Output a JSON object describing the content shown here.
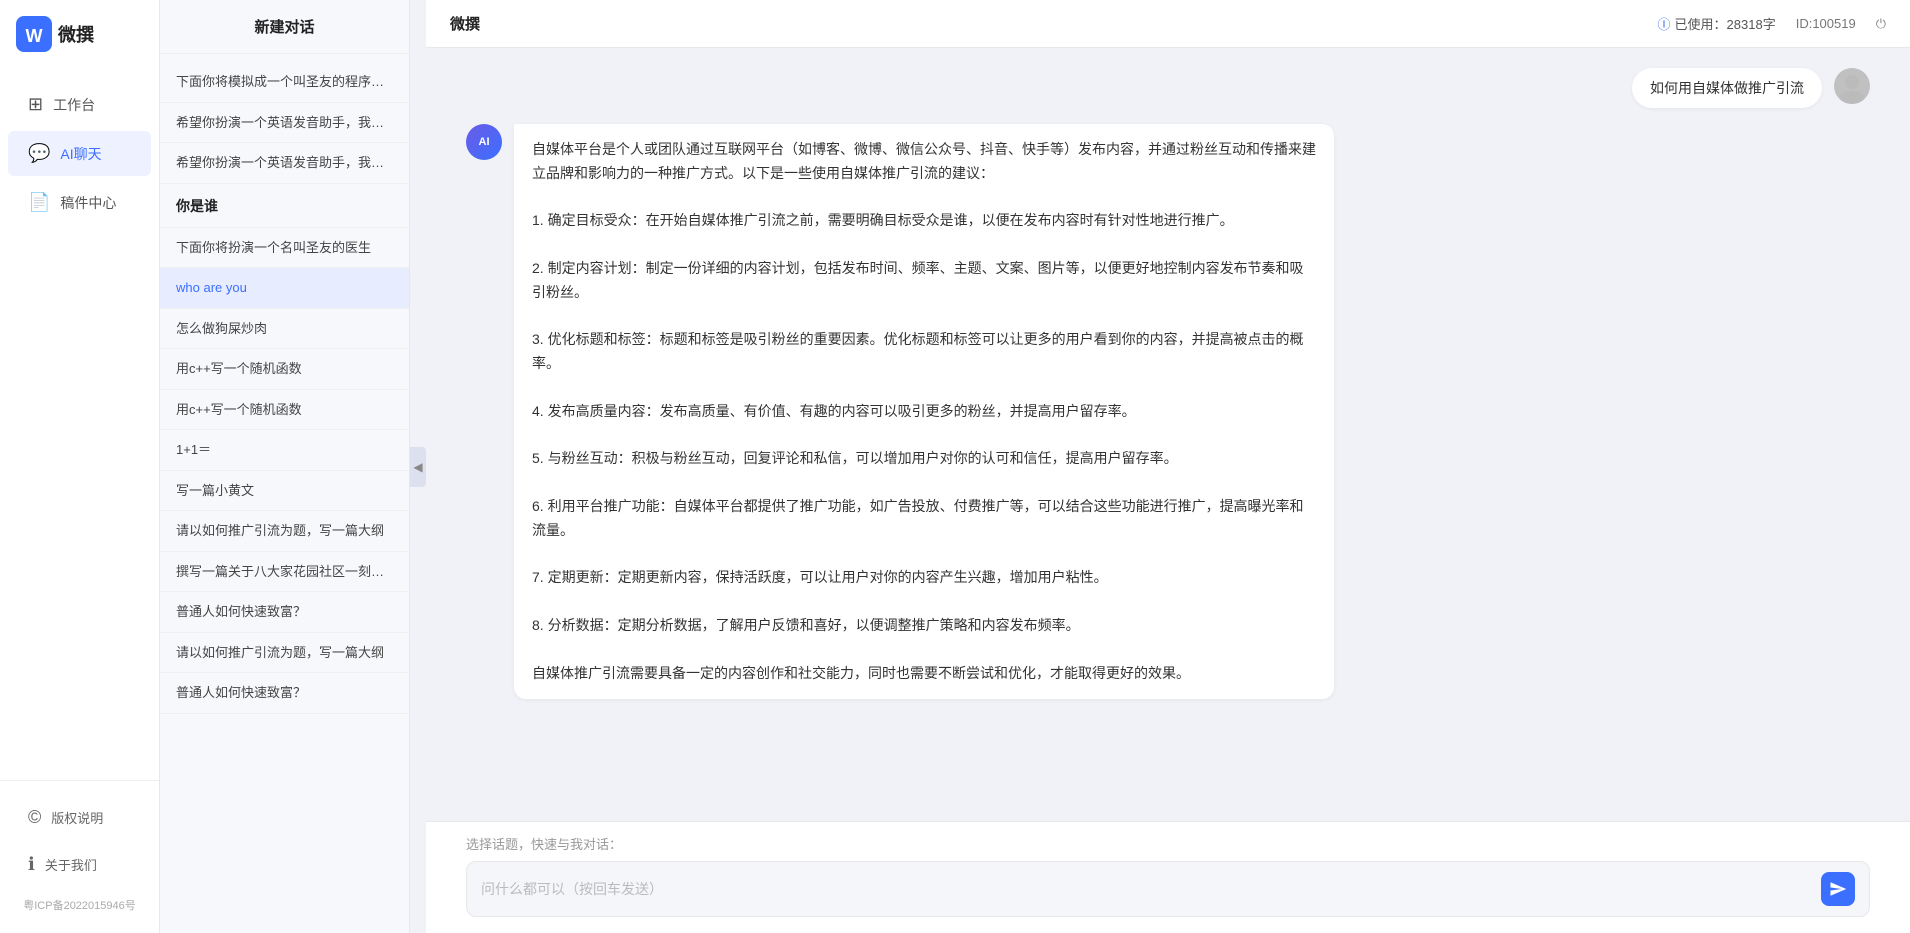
{
  "app": {
    "title": "微撰",
    "logo_text": "微撰"
  },
  "topbar": {
    "title": "微撰",
    "token_label": "已使用：28318字",
    "id_label": "ID:100519",
    "token_icon": "ℹ"
  },
  "left_nav": {
    "items": [
      {
        "id": "workbench",
        "label": "工作台",
        "icon": "⊞"
      },
      {
        "id": "ai-chat",
        "label": "AI聊天",
        "icon": "💬",
        "active": true
      },
      {
        "id": "drafts",
        "label": "稿件中心",
        "icon": "📄"
      }
    ],
    "bottom_items": [
      {
        "id": "copyright",
        "label": "版权说明",
        "icon": "©"
      },
      {
        "id": "about",
        "label": "关于我们",
        "icon": "ℹ"
      }
    ],
    "icp": "粤ICP备2022015946号"
  },
  "conversation_list": {
    "new_chat_label": "新建对话",
    "items": [
      {
        "id": 1,
        "text": "下面你将模拟成一个叫圣友的程序员，我说...",
        "active": false
      },
      {
        "id": 2,
        "text": "希望你扮演一个英语发音助手，我提供给你...",
        "active": false
      },
      {
        "id": 3,
        "text": "希望你扮演一个英语发音助手，我提供给你...",
        "active": false
      },
      {
        "id": 4,
        "text": "你是谁",
        "active": false,
        "section": true
      },
      {
        "id": 5,
        "text": "下面你将扮演一个名叫圣友的医生",
        "active": false
      },
      {
        "id": 6,
        "text": "who are you",
        "active": true
      },
      {
        "id": 7,
        "text": "怎么做狗屎炒肉",
        "active": false
      },
      {
        "id": 8,
        "text": "用c++写一个随机函数",
        "active": false
      },
      {
        "id": 9,
        "text": "用c++写一个随机函数",
        "active": false
      },
      {
        "id": 10,
        "text": "1+1＝",
        "active": false
      },
      {
        "id": 11,
        "text": "写一篇小黄文",
        "active": false
      },
      {
        "id": 12,
        "text": "请以如何推广引流为题，写一篇大纲",
        "active": false
      },
      {
        "id": 13,
        "text": "撰写一篇关于八大家花园社区一刻钟便民生...",
        "active": false
      },
      {
        "id": 14,
        "text": "普通人如何快速致富？",
        "active": false
      },
      {
        "id": 15,
        "text": "请以如何推广引流为题，写一篇大纲",
        "active": false
      },
      {
        "id": 16,
        "text": "普通人如何快速致富？",
        "active": false
      }
    ]
  },
  "chat": {
    "user_question": "如何用自媒体做推广引流",
    "ai_response_paragraphs": [
      "自媒体平台是个人或团队通过互联网平台（如博客、微博、微信公众号、抖音、快手等）发布内容，并通过粉丝互动和传播来建立品牌和影响力的一种推广方式。以下是一些使用自媒体推广引流的建议：",
      "1. 确定目标受众：在开始自媒体推广引流之前，需要明确目标受众是谁，以便在发布内容时有针对性地进行推广。",
      "2. 制定内容计划：制定一份详细的内容计划，包括发布时间、频率、主题、文案、图片等，以便更好地控制内容发布节奏和吸引粉丝。",
      "3. 优化标题和标签：标题和标签是吸引粉丝的重要因素。优化标题和标签可以让更多的用户看到你的内容，并提高被点击的概率。",
      "4. 发布高质量内容：发布高质量、有价值、有趣的内容可以吸引更多的粉丝，并提高用户留存率。",
      "5. 与粉丝互动：积极与粉丝互动，回复评论和私信，可以增加用户对你的认可和信任，提高用户留存率。",
      "6. 利用平台推广功能：自媒体平台都提供了推广功能，如广告投放、付费推广等，可以结合这些功能进行推广，提高曝光率和流量。",
      "7. 定期更新：定期更新内容，保持活跃度，可以让用户对你的内容产生兴趣，增加用户粘性。",
      "8. 分析数据：定期分析数据，了解用户反馈和喜好，以便调整推广策略和内容发布频率。",
      "自媒体推广引流需要具备一定的内容创作和社交能力，同时也需要不断尝试和优化，才能取得更好的效果。"
    ]
  },
  "input": {
    "quick_prompts_label": "选择话题，快速与我对话：",
    "placeholder": "问什么都可以（按回车发送）"
  }
}
